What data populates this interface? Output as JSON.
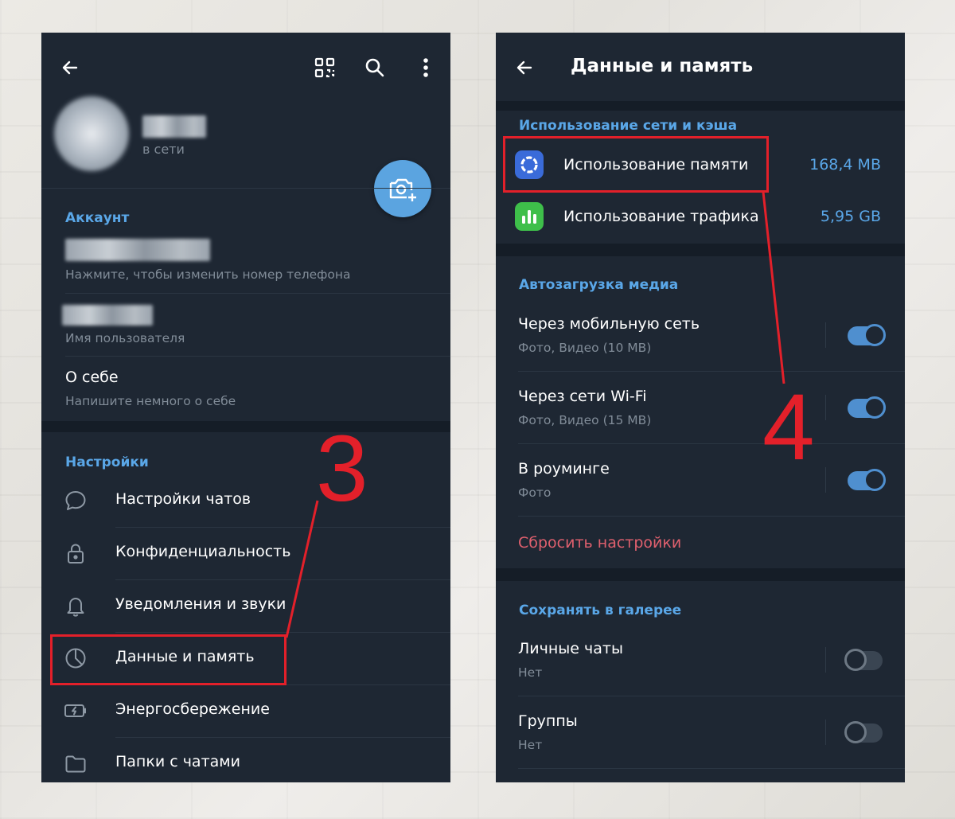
{
  "left": {
    "status": "в сети",
    "account_section": "Аккаунт",
    "phone_hint": "Нажмите, чтобы изменить номер телефона",
    "username_hint": "Имя пользователя",
    "bio_title": "О себе",
    "bio_hint": "Напишите немного о себе",
    "settings_section": "Настройки",
    "menu": [
      {
        "label": "Настройки чатов",
        "icon": "chat-bubble-icon"
      },
      {
        "label": "Конфиденциальность",
        "icon": "lock-icon"
      },
      {
        "label": "Уведомления и звуки",
        "icon": "bell-icon"
      },
      {
        "label": "Данные и память",
        "icon": "pie-chart-icon"
      },
      {
        "label": "Энергосбережение",
        "icon": "battery-icon"
      },
      {
        "label": "Папки с чатами",
        "icon": "folder-icon"
      }
    ],
    "annotation": "3"
  },
  "right": {
    "title": "Данные и память",
    "usage_section": "Использование сети и кэша",
    "storage_label": "Использование памяти",
    "storage_value": "168,4 MB",
    "traffic_label": "Использование трафика",
    "traffic_value": "5,95 GB",
    "autodownload_section": "Автозагрузка медиа",
    "mobile_label": "Через мобильную сеть",
    "mobile_sub": "Фото, Видео (10 MB)",
    "mobile_on": true,
    "wifi_label": "Через сети Wi-Fi",
    "wifi_sub": "Фото, Видео (15 MB)",
    "wifi_on": true,
    "roaming_label": "В роуминге",
    "roaming_sub": "Фото",
    "roaming_on": true,
    "reset_label": "Сбросить настройки",
    "gallery_section": "Сохранять в галерее",
    "private_label": "Личные чаты",
    "private_sub": "Нет",
    "private_on": false,
    "groups_label": "Группы",
    "groups_sub": "Нет",
    "groups_on": false,
    "annotation": "4"
  },
  "colors": {
    "background": "#1e2733",
    "accent": "#5aa7e8",
    "annotation_red": "#e3202a",
    "reset_red": "#e0606e"
  }
}
